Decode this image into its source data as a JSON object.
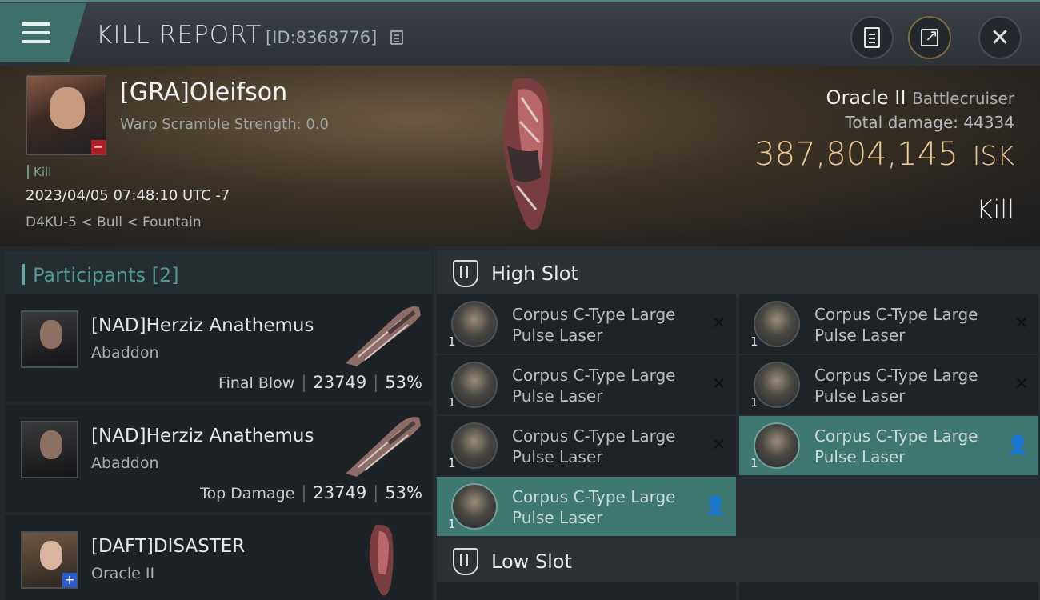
{
  "header": {
    "title": "KILL REPORT",
    "report_id": "[ID:8368776]"
  },
  "victim": {
    "name": "[GRA]Oleifson",
    "warp_scramble": "Warp Scramble Strength: 0.0",
    "kill_tag": "Kill",
    "datetime": "2023/04/05 07:48:10 UTC -7",
    "location": "D4KU-5 < Bull < Fountain",
    "ship_name": "Oracle II",
    "ship_class": "Battlecruiser",
    "total_damage_label": "Total damage:",
    "total_damage": "44334",
    "isk_value": "387,804,145",
    "isk_unit": "ISK",
    "result": "Kill"
  },
  "participants": {
    "label": "Participants [2]",
    "rows": [
      {
        "name": "[NAD]Herziz Anathemus",
        "ship": "Abaddon",
        "stat_label": "Final Blow",
        "damage": "23749",
        "percent": "53%"
      },
      {
        "name": "[NAD]Herziz Anathemus",
        "ship": "Abaddon",
        "stat_label": "Top Damage",
        "damage": "23749",
        "percent": "53%"
      },
      {
        "name": "[DAFT]DISASTER",
        "ship": "Oracle II"
      }
    ]
  },
  "slots": {
    "high_label": "High Slot",
    "low_label": "Low Slot",
    "items": [
      {
        "name": "Corpus C-Type Large Pulse Laser",
        "qty": "1",
        "status": "destroyed"
      },
      {
        "name": "Corpus C-Type Large Pulse Laser",
        "qty": "1",
        "status": "destroyed"
      },
      {
        "name": "Corpus C-Type Large Pulse Laser",
        "qty": "1",
        "status": "destroyed"
      },
      {
        "name": "Corpus C-Type Large Pulse Laser",
        "qty": "1",
        "status": "destroyed"
      },
      {
        "name": "Corpus C-Type Large Pulse Laser",
        "qty": "1",
        "status": "destroyed"
      },
      {
        "name": "Corpus C-Type Large Pulse Laser",
        "qty": "1",
        "status": "dropped"
      },
      {
        "name": "Corpus C-Type Large Pulse Laser",
        "qty": "1",
        "status": "dropped"
      }
    ]
  },
  "colors": {
    "accent": "#3e7871",
    "isk": "#e9c78d",
    "destroyed_badge": "#b01d22",
    "ally_badge": "#2a5bd1"
  },
  "icons": [
    "menu-icon",
    "copy-icon",
    "clipboard-icon",
    "share-icon",
    "close-icon",
    "shield-icon",
    "close-x-icon",
    "person-icon"
  ]
}
